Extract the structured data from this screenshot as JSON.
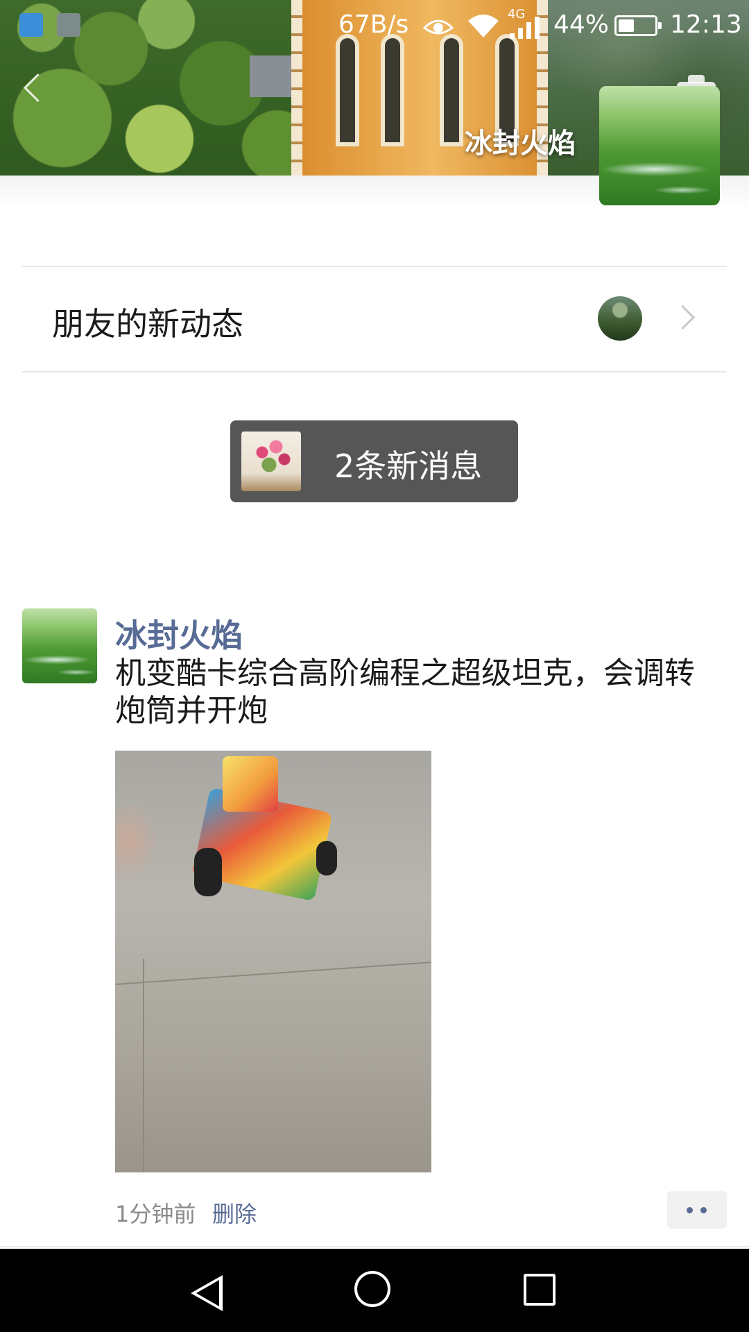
{
  "status_bar": {
    "network_speed": "67B/s",
    "signal_type": "4G",
    "battery_percent": "44%",
    "battery_level": 0.44,
    "time": "12:13",
    "icons": [
      "health-app-icon",
      "gallery-app-icon",
      "eye-comfort-icon",
      "wifi-icon",
      "cellular-signal-icon",
      "battery-icon"
    ]
  },
  "header": {
    "profile_name": "冰封火焰",
    "icons": [
      "back-arrow-icon",
      "camera-icon"
    ]
  },
  "friends_updates": {
    "label": "朋友的新动态"
  },
  "new_messages": {
    "label": "2条新消息"
  },
  "post": {
    "author": "冰封火焰",
    "text": "机变酷卡综合高阶编程之超级坦克，会调转炮筒并开炮",
    "time": "1分钟前",
    "delete_label": "删除"
  },
  "nav_bar": {
    "icons": [
      "nav-back-icon",
      "nav-home-icon",
      "nav-recent-apps-icon"
    ]
  },
  "colors": {
    "link_blue": "#586b95",
    "pill_background": "#565656",
    "nav_background": "#000000"
  }
}
